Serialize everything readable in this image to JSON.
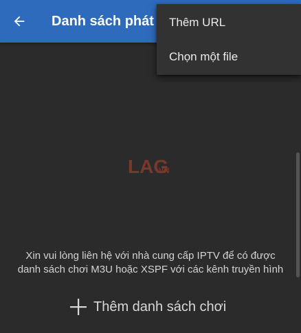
{
  "app_bar": {
    "title": "Danh sách phát",
    "back_icon": "arrow-left-icon",
    "color": "#2e6bbd"
  },
  "overflow_menu": {
    "items": [
      {
        "label": "Thêm URL"
      },
      {
        "label": "Chọn một file"
      }
    ]
  },
  "watermark": {
    "text_main": "LAG",
    "text_sub": ".VN"
  },
  "empty_state": {
    "message_line1": "Xin vui lòng liên hệ với nhà cung cấp IPTV để có được",
    "message_line2": "danh sách chơi M3U hoặc XSPF với các kênh truyền hình"
  },
  "add_playlist": {
    "label": "Thêm danh sách chơi",
    "icon": "plus-icon"
  },
  "colors": {
    "background": "#2b2b2b",
    "menu_background": "#323232",
    "text": "#d8d8d8"
  }
}
